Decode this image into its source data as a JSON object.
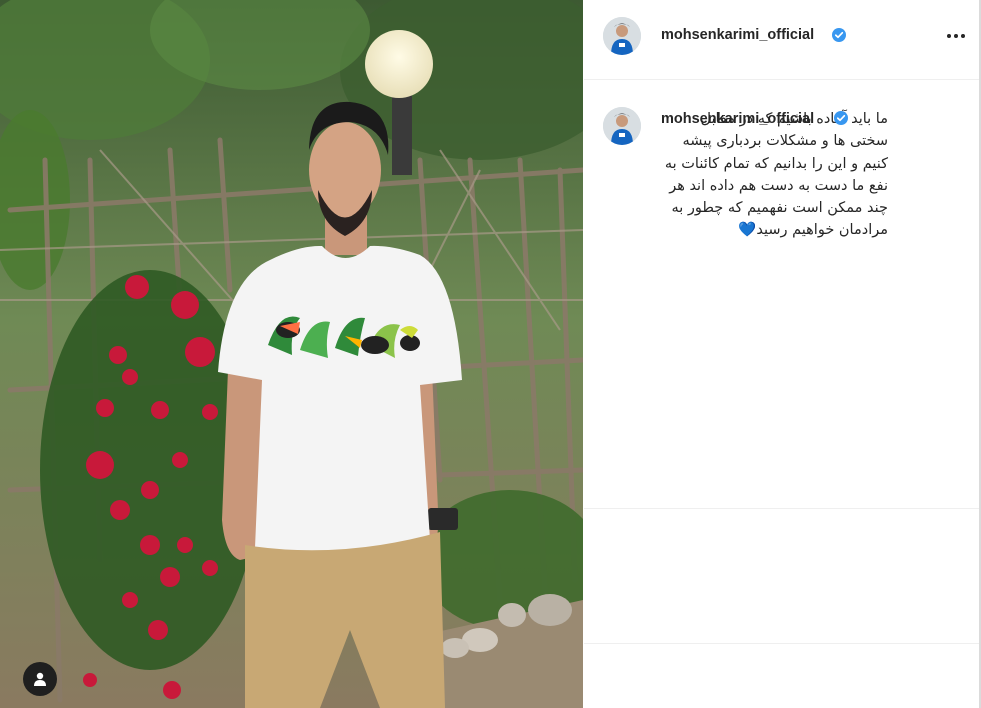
{
  "post": {
    "username": "mohsenkarimi_official",
    "verified": true,
    "more_icon": "more-horizontal-icon",
    "caption": {
      "username": "mohsenkarimi_official",
      "text": "ما باید آماده باشیم که در مقابل سختی ها و مشکلات بردباری پیشه کنیم و این را بدانیم که تمام کائنات به نفع ما دست به دست هم داده اند هر چند ممکن است نفهمیم که چطور به مرادمان خواهیم رسید",
      "emoji": "💙"
    },
    "photo": {
      "tag_icon": "user-tag-icon"
    }
  },
  "colors": {
    "verified_badge": "#3897f0",
    "text": "#262626",
    "divider": "#efefef"
  }
}
